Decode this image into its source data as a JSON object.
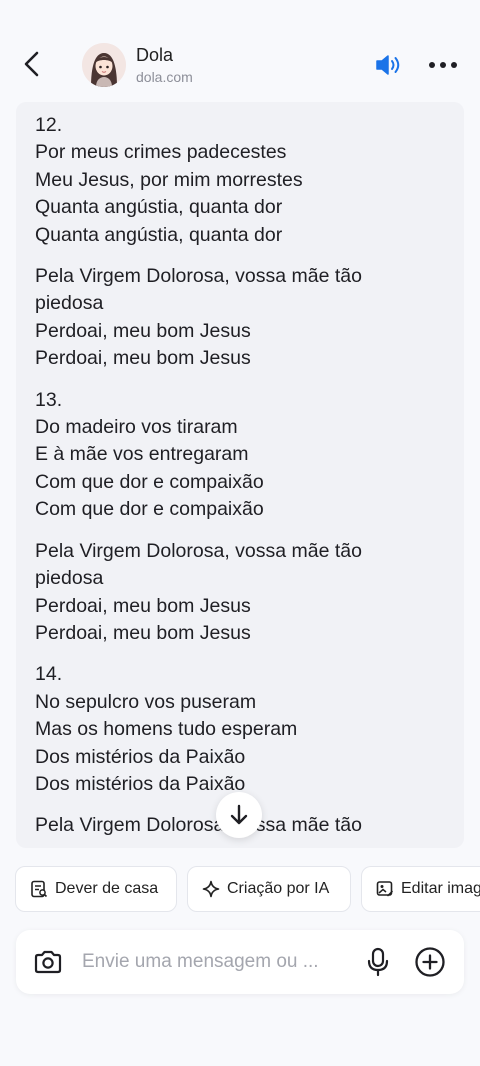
{
  "header": {
    "title": "Dola",
    "subtitle": "dola.com",
    "back_icon": "chevron-left-icon",
    "speaker_icon": "speaker-icon",
    "more_icon": "more-horizontal-icon",
    "accent_color": "#1a73e8"
  },
  "message": {
    "stanzas": [
      {
        "lines": [
          "12.",
          "Por meus crimes padecestes",
          "Meu Jesus, por mim morrestes",
          "Quanta angústia, quanta dor",
          "Quanta angústia, quanta dor"
        ]
      },
      {
        "lines": [
          "Pela Virgem Dolorosa, vossa mãe tão",
          "piedosa",
          "Perdoai, meu bom Jesus",
          "Perdoai, meu bom Jesus"
        ]
      },
      {
        "lines": [
          "13.",
          "Do madeiro vos tiraram",
          "E à mãe vos entregaram",
          "Com que dor e compaixão",
          "Com que dor e compaixão"
        ]
      },
      {
        "lines": [
          "Pela Virgem Dolorosa, vossa mãe tão",
          "piedosa",
          "Perdoai, meu bom Jesus",
          "Perdoai, meu bom Jesus"
        ]
      },
      {
        "lines": [
          "14.",
          "No sepulcro vos puseram",
          "Mas os homens tudo esperam",
          "Dos mistérios da Paixão",
          "Dos mistérios da Paixão"
        ]
      },
      {
        "lines": [
          "Pela Virgem Dolorosa, vossa mãe tão"
        ]
      }
    ]
  },
  "scroll_button": {
    "icon": "arrow-down-icon"
  },
  "chips": [
    {
      "label": "Dever de casa",
      "icon": "homework-icon"
    },
    {
      "label": "Criação por IA",
      "icon": "sparkle-icon"
    },
    {
      "label": "Editar imagem",
      "icon": "edit-image-icon"
    }
  ],
  "composer": {
    "placeholder": "Envie uma mensagem ou ...",
    "camera_icon": "camera-icon",
    "mic_icon": "microphone-icon",
    "plus_icon": "plus-circle-icon"
  }
}
